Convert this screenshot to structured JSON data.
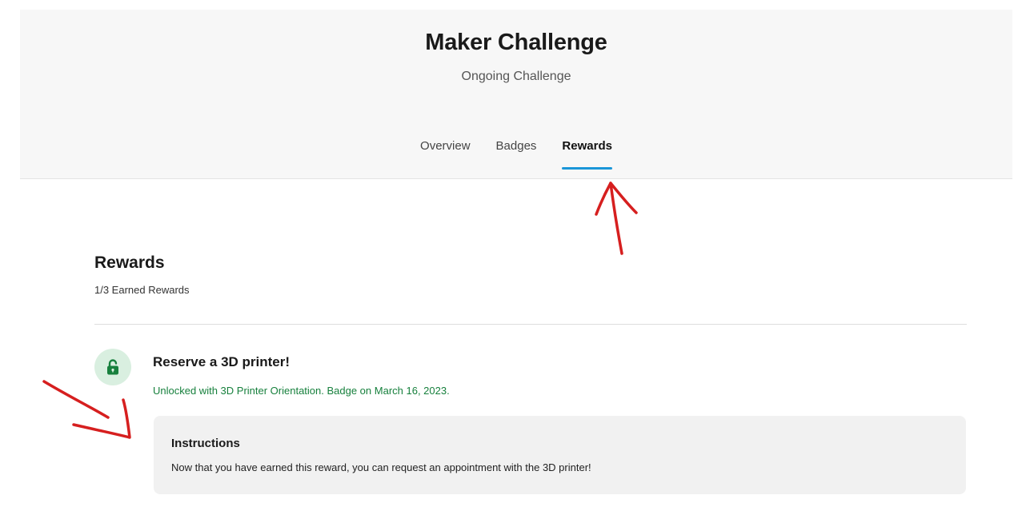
{
  "header": {
    "title": "Maker Challenge",
    "subtitle": "Ongoing Challenge",
    "tabs": [
      {
        "label": "Overview",
        "active": false
      },
      {
        "label": "Badges",
        "active": false
      },
      {
        "label": "Rewards",
        "active": true
      }
    ]
  },
  "rewards": {
    "title": "Rewards",
    "count": "1/3 Earned Rewards",
    "items": [
      {
        "icon": "unlocked-padlock-icon",
        "title": "Reserve a 3D printer!",
        "unlocked_text": "Unlocked with 3D Printer Orientation. Badge on March 16, 2023.",
        "instructions_title": "Instructions",
        "instructions_text": "Now that you have earned this reward, you can request an appointment with the 3D printer!"
      }
    ]
  },
  "colors": {
    "header_bg": "#f7f7f7",
    "tab_underline": "#1a96d8",
    "unlocked_green": "#17803d",
    "icon_bg": "#d9efe0",
    "annotation_red": "#d61f1f"
  }
}
